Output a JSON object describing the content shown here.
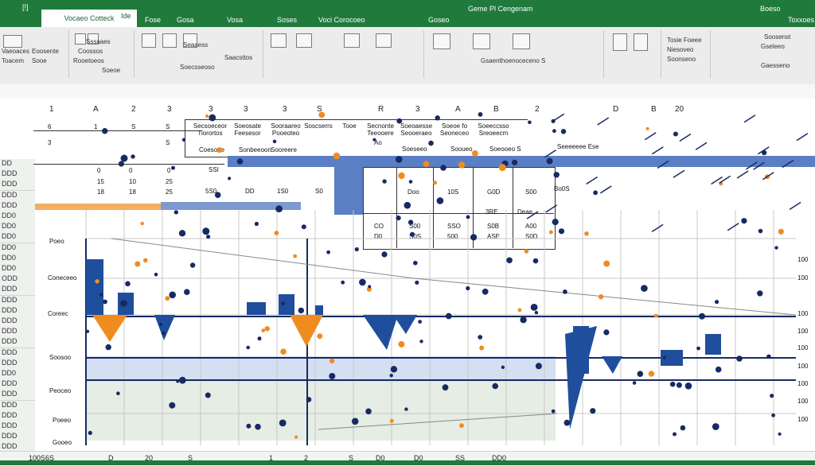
{
  "title_bar": {
    "tabs": [
      "[!]",
      "Vocaeo Cotteck",
      "Ide",
      "Fose",
      "Gosa",
      "Vosa",
      "Soses",
      "Voci Corocoeo",
      "Goseo"
    ],
    "active_tab_index": 1,
    "window_title": "Geme Pl Cengenam",
    "right_labels": [
      "Boeso",
      "Toxxoes"
    ],
    "accent_color": "#1f7a3c"
  },
  "ribbon": {
    "left_labels": [
      "Vaeoaces",
      "Eoosente",
      "Toacem",
      "Sooe"
    ],
    "labels_g2": [
      "Sssaaes",
      "Coossos",
      "Rooetoeos",
      "Soeoe"
    ],
    "labels_g3": [
      "Seaaess",
      "Saacsttos",
      "Soecsseoso"
    ],
    "center_label": "Gsaenthoenoceceno S",
    "right_group_labels": [
      "Tosie Foeee",
      "Niesoveo",
      "Soonseno"
    ],
    "far_right_labels": [
      "Soosenst",
      "Gseleeo",
      "Gaesseno"
    ]
  },
  "columns": [
    "1",
    "A",
    "2",
    "3",
    "3",
    "3",
    "3",
    "S",
    "R",
    "3",
    "A",
    "B",
    "2",
    "D",
    "B",
    "20"
  ],
  "row_headers": [
    "DD",
    "DDD",
    "DDD",
    "DDD",
    "DDD",
    "DD0",
    "DD0",
    "DD0",
    "DD0",
    "DD0",
    "DD0",
    "ODD",
    "DDD",
    "DDD",
    "DDD",
    "DDD",
    "DDD",
    "DDD",
    "DDD",
    "DDD",
    "DD0",
    "DDD",
    "DDD",
    "DDD",
    "DDD",
    "DDD",
    "DDD",
    "DDD"
  ],
  "table_top": {
    "header_row": [
      "6",
      "1",
      "S",
      "S"
    ],
    "cells_row2": [
      "3",
      "",
      "",
      "S"
    ],
    "text_cells": [
      "Secsoeceor Tiorortos",
      "Soeosate Feesesor",
      "Sooraareo Pooeoteo",
      "Soscserrs",
      "Secnonte Teeooere",
      "Soeoaesse Seooeraeo",
      "Soeoe fo Seoneceo",
      "Soeeccsso Sreoeecm",
      "Sonbeeoon",
      "Sooreere",
      "Tooe",
      "Ao",
      "Soeseeo",
      "Sooueo",
      "Soeooeo S",
      "Seeeeeee Ese",
      "Coesooe"
    ],
    "num_rows": [
      [
        "0",
        "0",
        "0"
      ],
      [
        "15",
        "10",
        "25"
      ],
      [
        "18",
        "18",
        "25"
      ]
    ],
    "mid_values": [
      "SSI",
      "5S0",
      "1S0",
      "DD",
      "S0"
    ],
    "lower_values": [
      "Doo",
      "10S",
      "G0D",
      "Seoe"
    ],
    "box_values": [
      "CO",
      "D0",
      "S00",
      "S0S",
      "SSO",
      "500",
      "S0B",
      "ASE",
      "A00",
      "S0D",
      "S00",
      "Deae",
      "Bo0S",
      "3RE"
    ]
  },
  "chart": {
    "y_labels": [
      "Poeo",
      "Coneceeo",
      "Coreec",
      "Soosoo",
      "Peoceo",
      "Poeeo",
      "Gooeo"
    ],
    "x_labels": [
      "20",
      "20",
      "S",
      "1",
      "2",
      "S",
      "D0",
      "D0",
      "SS",
      "DD0",
      "SD"
    ],
    "right_axis": [
      "100",
      "100",
      "100",
      "100",
      "100",
      "100",
      "100",
      "100",
      "100"
    ]
  },
  "status_bar": {
    "left": "100S6S",
    "values": [
      "D",
      "20",
      "S",
      "1",
      "2",
      "S",
      "D0",
      "D0",
      "SS",
      "DD0"
    ]
  },
  "colors": {
    "blue": "#1f4e9c",
    "navy": "#172a63",
    "orange": "#f08c1f",
    "light_blue": "#c9d7ee",
    "light_green": "#dfe9dd"
  }
}
